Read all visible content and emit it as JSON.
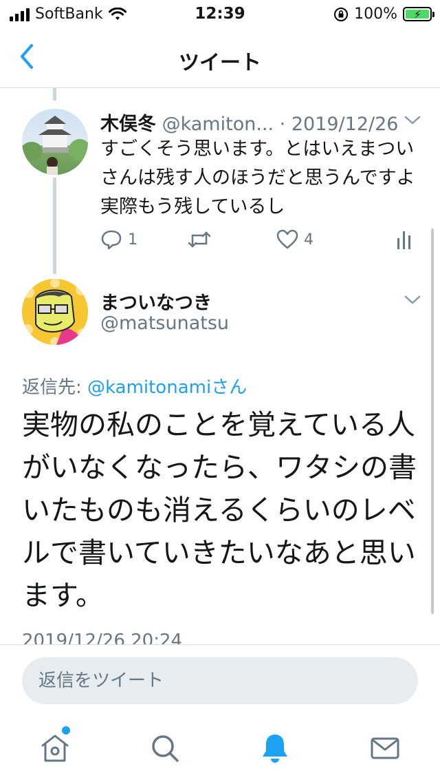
{
  "status_bar": {
    "carrier": "SoftBank",
    "time": "12:39",
    "battery_percent": "100%",
    "battery_level": 1.0
  },
  "header": {
    "back_icon": "chevron-left-icon",
    "title": "ツイート"
  },
  "parent_tweet": {
    "name": "木俣冬",
    "handle": "@kamiton...",
    "date": "· 2019/12/26",
    "text": "すごくそう思います。とはいえまついさんは残す人のほうだと思うんですよ　実際もう残しているし",
    "reply_count": "1",
    "like_count": "4",
    "icons": [
      "reply-icon",
      "retweet-icon",
      "like-icon",
      "analytics-icon"
    ]
  },
  "main_tweet": {
    "name": "まついなつき",
    "handle": "@matsunatsu",
    "reply_to_label": "返信先: ",
    "reply_to_mention": "@kamitonami",
    "reply_to_suffix": "さん",
    "text": "実物の私のことを覚えている人がいなくなったら、ワタシの書いたものも消えるくらいのレベルで書いていきたいなあと思います。",
    "timestamp": "2019/12/26 20:24"
  },
  "composer": {
    "placeholder": "返信をツイート"
  },
  "tabbar": {
    "items": [
      "home-icon",
      "search-icon",
      "notifications-icon",
      "messages-icon"
    ]
  },
  "colors": {
    "accent": "#1da1f2",
    "secondary_text": "#657786",
    "divider": "#d6dde3"
  }
}
